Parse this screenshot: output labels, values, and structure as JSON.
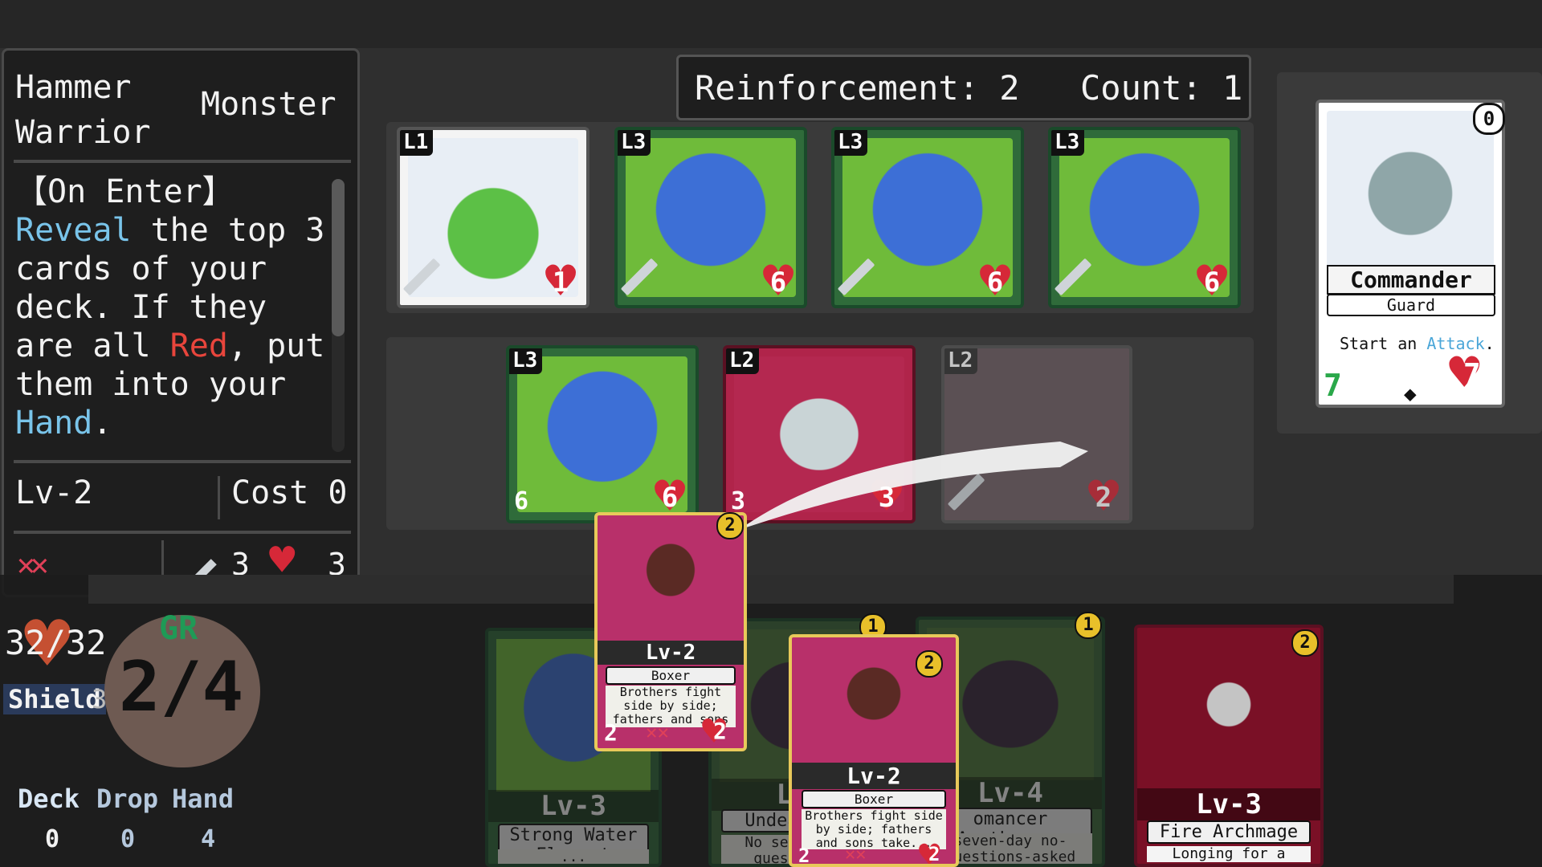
{
  "info_panel": {
    "name_line1": "Hammer",
    "name_line2": "Warrior",
    "type": "Monster",
    "desc_line1": "【On Enter】",
    "desc_line2a": "Reveal",
    "desc_line2b": " the top 3",
    "desc_line3": "cards of your",
    "desc_line4": "deck. If they",
    "desc_line5a": "are all ",
    "desc_line5b": "Red",
    "desc_line5c": ", put",
    "desc_line6": "them into your",
    "desc_line7a": "Hand",
    "desc_line7b": ".",
    "level": "Lv-2",
    "cost": "Cost 0",
    "marks": "✕✕",
    "attack": "3",
    "health": "3"
  },
  "reinforcement": {
    "label": "Reinforcement: 2",
    "count": "Count: 1"
  },
  "row1": [
    {
      "level": "L1",
      "hp": "1"
    },
    {
      "level": "L3",
      "hp": "6"
    },
    {
      "level": "L3",
      "hp": "6"
    },
    {
      "level": "L3",
      "hp": "6"
    }
  ],
  "row2": [
    {
      "level": "L3",
      "atk": "6",
      "hp": "6"
    },
    {
      "level": "L2",
      "atk": "3",
      "hp": "3"
    },
    {
      "level": "L2",
      "hp": "2"
    }
  ],
  "commander": {
    "corner": "0",
    "name": "Commander",
    "type": "Guard",
    "text_a": "Start an ",
    "text_b": "Attack",
    "text_c": ".",
    "atk": "7",
    "hp": "7"
  },
  "player": {
    "hp": "32/32",
    "shield_label": "Shield",
    "shield_value": "3",
    "gr_label": "GR",
    "gr_value": "2/4",
    "deck_label": "Deck",
    "drop_label": "Drop",
    "hand_label": "Hand",
    "deck_count": "0",
    "drop_count": "0",
    "hand_count": "4"
  },
  "dragged_card": {
    "cost": "2",
    "level": "Lv-2",
    "name": "Boxer",
    "flavor": "Brothers fight side by side; fathers and sons take...",
    "atk": "2",
    "hp": "2",
    "marks": "✕✕"
  },
  "hand": [
    {
      "level": "Lv-3",
      "name": "Strong Water Element",
      "flavor": "..."
    },
    {
      "level": "Lv",
      "name": "Undead Ap",
      "flavor": "No seven... questions",
      "cost": "1"
    },
    {
      "cost": "2",
      "level": "Lv-2",
      "name": "Boxer",
      "flavor": "Brothers fight side by side; fathers and sons take...",
      "atk": "2",
      "hp": "2",
      "marks": "✕✕"
    },
    {
      "level": "Lv-4",
      "name": "omancer Apothecary",
      "flavor": "seven-day no-questions-asked",
      "cost": "1"
    },
    {
      "level": "Lv-3",
      "name": "Fire Archmage",
      "flavor": "Longing for a",
      "cost": "2"
    }
  ],
  "colors": {
    "accent_cyan": "#79c4ea",
    "accent_red": "#e8453c",
    "gr_green": "#1f9a56",
    "coin_gold": "#e8c02a"
  }
}
